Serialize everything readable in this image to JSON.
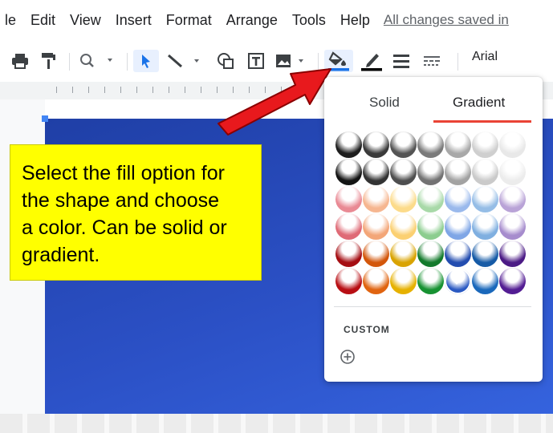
{
  "menubar": {
    "items": [
      "le",
      "Edit",
      "View",
      "Insert",
      "Format",
      "Arrange",
      "Tools",
      "Help"
    ],
    "save_status": "All changes saved in"
  },
  "toolbar": {
    "font_name": "Arial",
    "icons": [
      "print-icon",
      "paint-format-icon",
      "zoom-icon",
      "select-icon",
      "line-icon",
      "shape-icon",
      "textbox-icon",
      "image-icon",
      "fill-color-icon",
      "border-color-icon",
      "border-weight-icon",
      "border-dash-icon"
    ],
    "fill_color_underline": "#1a73e8"
  },
  "callout": {
    "text_lines": [
      "Select the fill option for",
      "the shape and choose",
      "a color. Can be solid or",
      "gradient."
    ]
  },
  "fill_popup": {
    "tabs": [
      {
        "label": "Solid",
        "active": false
      },
      {
        "label": "Gradient",
        "active": true
      }
    ],
    "active_tab_color": "#ea4335",
    "swatch_rows": [
      [
        "#1e1e1e",
        "#3a3a3a",
        "#545454",
        "#7a7a7a",
        "#a8a8a8",
        "#cfcfcf",
        "#e8e8e8"
      ],
      [
        "#141414",
        "#333333",
        "#4e4e4e",
        "#727272",
        "#a2a2a2",
        "#cacaca",
        "#ececec"
      ],
      [
        "#e98a94",
        "#f6b690",
        "#fcdb8a",
        "#a8d9a8",
        "#9ab9ec",
        "#95bde6",
        "#b9a3d7"
      ],
      [
        "#df6a76",
        "#f3a678",
        "#fbd072",
        "#8ccd8f",
        "#7fa6e6",
        "#7fafe0",
        "#a68ccd"
      ],
      [
        "#a50d12",
        "#d3560a",
        "#d9a300",
        "#137a2c",
        "#234db0",
        "#155aa6",
        "#4b1a85"
      ],
      [
        "#b80f14",
        "#e06410",
        "#e6b100",
        "#179232",
        "#2a59c2",
        "#1a68bb",
        "#531d93"
      ]
    ],
    "selected_swatch": "5-4",
    "custom_label": "CUSTOM"
  },
  "canvas": {
    "shape_color": "#2b50c5",
    "callout_color": "#ffff00",
    "arrow_color": "#e8191d"
  }
}
